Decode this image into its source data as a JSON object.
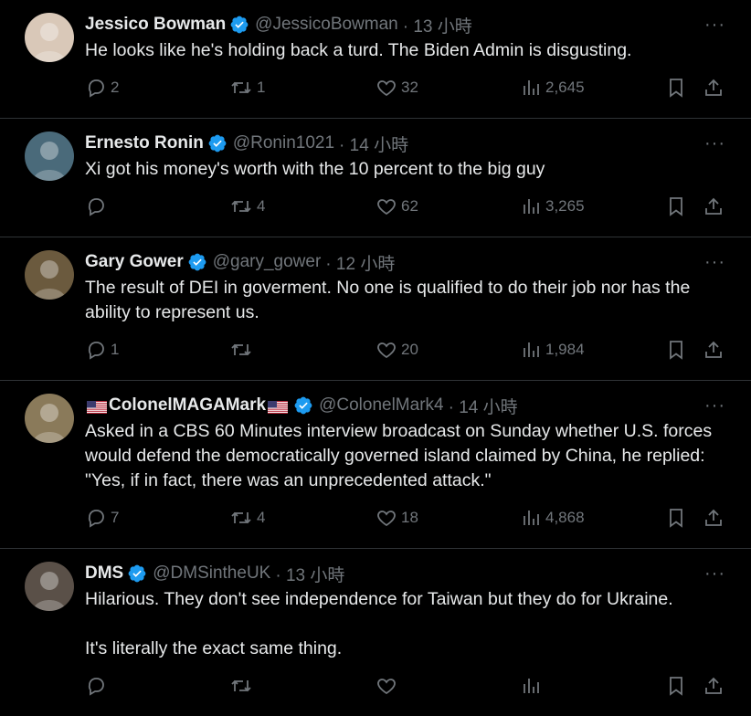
{
  "tweets": [
    {
      "name": "Jessico Bowman",
      "name_prefix_flag": false,
      "name_suffix_flag": false,
      "handle": "@JessicoBowman",
      "time": "· 13 小時",
      "text": "He looks like he's holding back a turd. The Biden Admin is disgusting.",
      "replies": "2",
      "retweets": "1",
      "likes": "32",
      "views": "2,645",
      "avatar_color": "#d9c8b8"
    },
    {
      "name": "Ernesto Ronin",
      "name_prefix_flag": false,
      "name_suffix_flag": false,
      "handle": "@Ronin1021",
      "time": "· 14 小時",
      "text": "Xi got his money's worth with the 10 percent to the big guy",
      "replies": "",
      "retweets": "4",
      "likes": "62",
      "views": "3,265",
      "avatar_color": "#4a6a7a"
    },
    {
      "name": "Gary Gower",
      "name_prefix_flag": false,
      "name_suffix_flag": false,
      "handle": "@gary_gower",
      "time": "· 12 小時",
      "text": "The result of DEI in goverment. No one is qualified to do their job nor has the ability to represent us.",
      "replies": "1",
      "retweets": "",
      "likes": "20",
      "views": "1,984",
      "avatar_color": "#6b5a3e"
    },
    {
      "name": "ColonelMAGAMark",
      "name_prefix_flag": true,
      "name_suffix_flag": true,
      "handle": "@ColonelMark4",
      "time": "· 14 小時",
      "text": "Asked in a CBS 60 Minutes interview broadcast on Sunday whether U.S. forces would defend the democratically governed island claimed by China, he replied: \"Yes, if in fact, there was an unprecedented attack.\"",
      "replies": "7",
      "retweets": "4",
      "likes": "18",
      "views": "4,868",
      "avatar_color": "#8a7a5a"
    },
    {
      "name": "DMS",
      "name_prefix_flag": false,
      "name_suffix_flag": false,
      "handle": "@DMSintheUK",
      "time": "· 13 小時",
      "text": "Hilarious. They don't see independence for Taiwan but they do for Ukraine.\n\nIt's literally the exact same thing.",
      "replies": "",
      "retweets": "",
      "likes": "",
      "views": "",
      "avatar_color": "#5a5048"
    }
  ],
  "colors": {
    "background": "#000000",
    "text": "#e7e9ea",
    "muted": "#71767b",
    "verified": "#1d9bf0",
    "divider": "#2f3336"
  },
  "icons": {
    "reply": "reply-icon",
    "retweet": "retweet-icon",
    "like": "heart-icon",
    "views": "views-icon",
    "bookmark": "bookmark-icon",
    "share": "share-icon",
    "more": "more-icon",
    "verified": "verified-badge-icon"
  }
}
